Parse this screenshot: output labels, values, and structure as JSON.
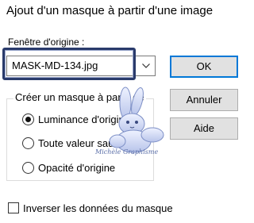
{
  "window": {
    "title": "Ajout d'un masque à partir d'une image"
  },
  "source": {
    "label": "Fenêtre d'origine :",
    "selected_value": "MASK-MD-134.jpg"
  },
  "buttons": {
    "ok": "OK",
    "cancel": "Annuler",
    "help": "Aide"
  },
  "mask_group": {
    "legend": "Créer un masque à partir de",
    "options": [
      {
        "label": "Luminance d'origine",
        "checked": true
      },
      {
        "label": "Toute valeur sauf zéro",
        "checked": false
      },
      {
        "label": "Opacité d'origine",
        "checked": false
      }
    ]
  },
  "invert": {
    "label": "Inverser les données du masque",
    "checked": false
  },
  "watermark": {
    "text": "Michèle Graphisme"
  },
  "colors": {
    "accent": "#0078d7",
    "highlight_frame": "#2a3b6b",
    "watermark": "#5b6fa8"
  },
  "icons": {
    "combo_arrow": "chevron-down-icon",
    "watermark": "bunny-watermark-icon"
  }
}
